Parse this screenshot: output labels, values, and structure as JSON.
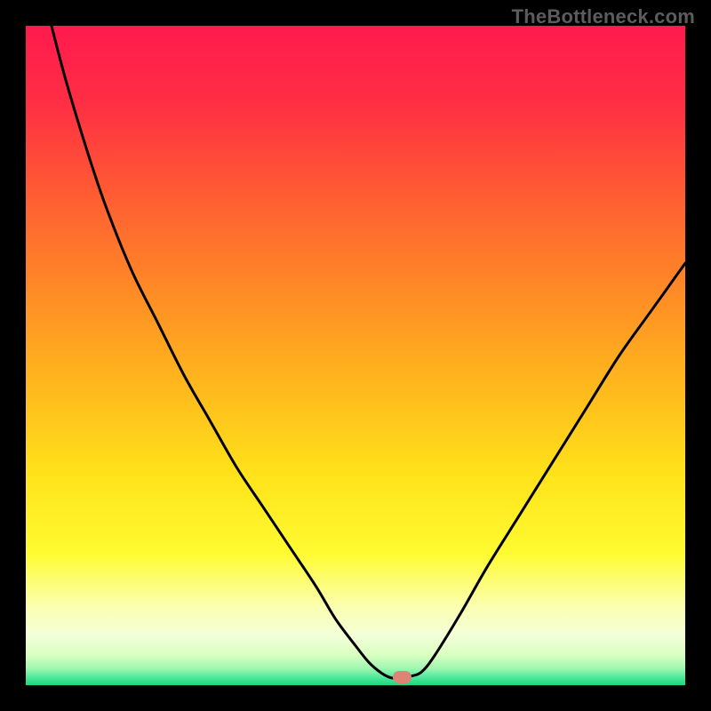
{
  "watermark": "TheBottleneck.com",
  "plot": {
    "border_px": 29,
    "inner_size": 742
  },
  "gradient_stops": [
    {
      "offset": 0.0,
      "color": "#ff1a4e"
    },
    {
      "offset": 0.12,
      "color": "#ff2f43"
    },
    {
      "offset": 0.25,
      "color": "#ff5a33"
    },
    {
      "offset": 0.4,
      "color": "#ff8a26"
    },
    {
      "offset": 0.55,
      "color": "#ffb91c"
    },
    {
      "offset": 0.68,
      "color": "#ffe21a"
    },
    {
      "offset": 0.8,
      "color": "#fffb31"
    },
    {
      "offset": 0.88,
      "color": "#fbffb0"
    },
    {
      "offset": 0.925,
      "color": "#f3ffd8"
    },
    {
      "offset": 0.955,
      "color": "#d8ffc0"
    },
    {
      "offset": 0.975,
      "color": "#9cf7b0"
    },
    {
      "offset": 0.988,
      "color": "#4fe89a"
    },
    {
      "offset": 1.0,
      "color": "#18d980"
    }
  ],
  "chart_data": {
    "type": "line",
    "title": "",
    "xlabel": "",
    "ylabel": "",
    "x_range": [
      0,
      100
    ],
    "y_range": [
      0,
      100
    ],
    "series": [
      {
        "name": "bottleneck-curve",
        "x": [
          3.9,
          6,
          9,
          12,
          16,
          20,
          24,
          28,
          32,
          36,
          40,
          44,
          47,
          50,
          52,
          54,
          55.5,
          57,
          58.5,
          60,
          62,
          66,
          70,
          75,
          80,
          85,
          90,
          95,
          100
        ],
        "y": [
          100,
          92,
          82,
          73,
          63,
          55,
          47,
          40,
          33,
          27,
          21,
          15,
          10,
          6,
          3.5,
          1.8,
          1.1,
          1.1,
          1.4,
          2.0,
          4.5,
          11,
          18,
          26,
          34,
          42,
          50,
          57,
          64
        ]
      }
    ],
    "marker": {
      "x": 57.0,
      "y": 1.2,
      "color": "#de8477"
    }
  }
}
